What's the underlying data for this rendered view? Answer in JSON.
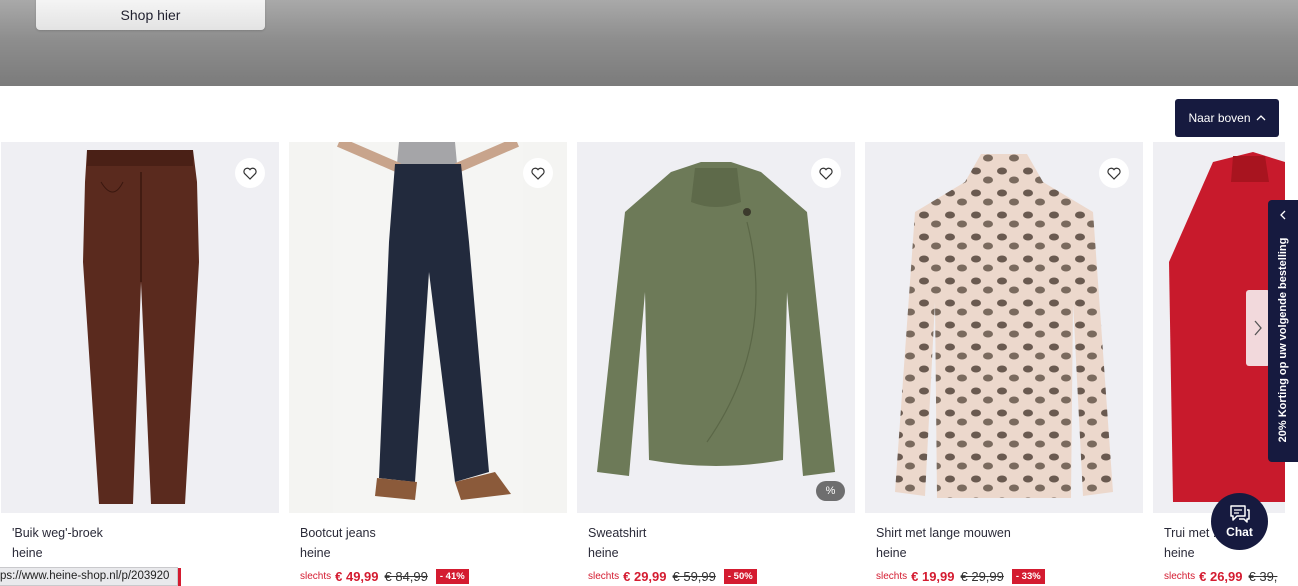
{
  "hero": {
    "shop_button": "Shop hier"
  },
  "back_to_top": {
    "label": "Naar boven"
  },
  "side_tab": {
    "label": "20% Korting op uw volgende bestelling"
  },
  "chat": {
    "label": "Chat"
  },
  "status_bar": {
    "url": "ps://www.heine-shop.nl/p/203920"
  },
  "products": [
    {
      "title": "'Buik weg'-broek",
      "brand": "heine",
      "slechts": "",
      "price": "",
      "old_price": "",
      "discount": ""
    },
    {
      "title": "Bootcut jeans",
      "brand": "heine",
      "slechts": "slechts",
      "price": "€ 49,99",
      "old_price": "€ 84,99",
      "discount": "- 41%"
    },
    {
      "title": "Sweatshirt",
      "brand": "heine",
      "slechts": "slechts",
      "price": "€ 29,99",
      "old_price": "€ 59,99",
      "discount": "- 50%",
      "badge": "%"
    },
    {
      "title": "Shirt met lange mouwen",
      "brand": "heine",
      "slechts": "slechts",
      "price": "€ 19,99",
      "old_price": "€ 29,99",
      "discount": "- 33%"
    },
    {
      "title": "Trui met ... e kr",
      "brand": "heine",
      "slechts": "slechts",
      "price": "€ 26,99",
      "old_price": "€ 39,",
      "discount": ""
    }
  ],
  "colors": {
    "navy": "#161a3f",
    "sale_red": "#d41b30",
    "image_bg": "#efeff3"
  }
}
